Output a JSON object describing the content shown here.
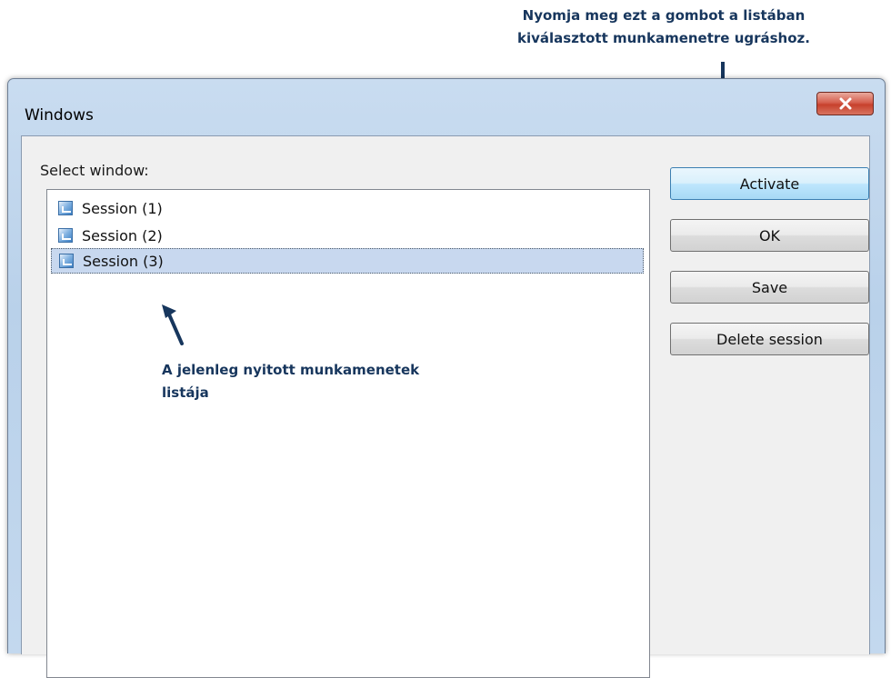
{
  "annotations": {
    "top_line1": "Nyomja meg ezt a gombot a listában",
    "top_line2": "kiválasztott munkamenetre ugráshoz.",
    "list_line1": "A jelenleg nyitott munkamenetek",
    "list_line2": "listája"
  },
  "window": {
    "title": "Windows",
    "close_glyph": "X"
  },
  "main": {
    "select_label": "Select window:",
    "items": [
      {
        "label": "Session (1)",
        "selected": false
      },
      {
        "label": "Session (2)",
        "selected": false
      },
      {
        "label": "Session (3)",
        "selected": true
      }
    ]
  },
  "buttons": {
    "activate": "Activate",
    "ok": "OK",
    "save": "Save",
    "delete": "Delete session"
  },
  "colors": {
    "annotation": "#17365d",
    "selection": "#c8d8ef",
    "default_button": "#bee6fd",
    "close_button": "#c7412d"
  },
  "icons": {
    "list_item": "session-window-icon",
    "close": "close-icon"
  }
}
